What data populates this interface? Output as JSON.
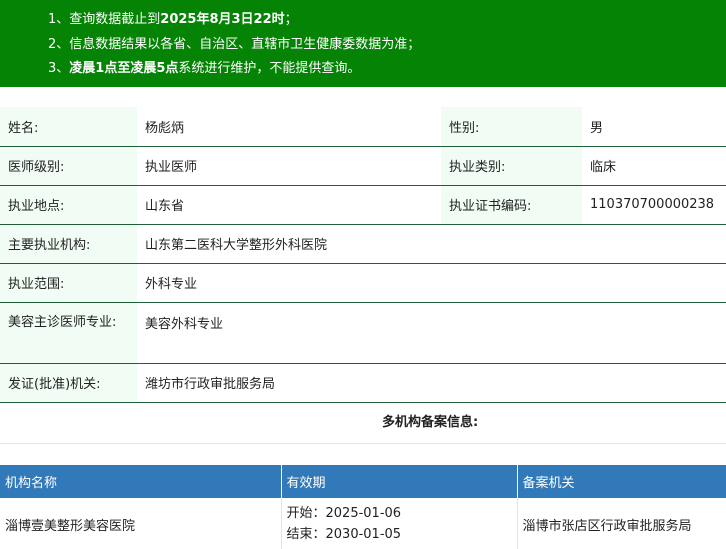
{
  "notice": {
    "line1_a": "1、查询数据截止到",
    "line1_b": "2025年8月3日22时",
    "line1_c": "；",
    "line2": "2、信息数据结果以各省、自治区、直辖市卫生健康委数据为准；",
    "line3_a": "3、",
    "line3_b": "凌晨1点至凌晨5点",
    "line3_c": "系统进行维护，不能提供查询。"
  },
  "info": {
    "name_label": "姓名:",
    "name_value": "杨彪炳",
    "gender_label": "性别:",
    "gender_value": "男",
    "level_label": "医师级别:",
    "level_value": "执业医师",
    "category_label": "执业类别:",
    "category_value": "临床",
    "location_label": "执业地点:",
    "location_value": "山东省",
    "cert_label": "执业证书编码:",
    "cert_value": "110370700000238",
    "org_label": "主要执业机构:",
    "org_value": "山东第二医科大学整形外科医院",
    "scope_label": "执业范围:",
    "scope_value": "外科专业",
    "cosmetic_label": "美容主诊医师专业:",
    "cosmetic_value": "美容外科专业",
    "issuer_label": "发证(批准)机关:",
    "issuer_value": "潍坊市行政审批服务局"
  },
  "multi": {
    "title": "多机构备案信息:",
    "headers": [
      "机构名称",
      "有效期",
      "备案机关"
    ],
    "rows": [
      {
        "org": "淄博壹美整形美容医院",
        "start": "开始：2025-01-06",
        "end": "结束：2030-01-05",
        "authority": "淄博市张店区行政审批服务局"
      }
    ]
  }
}
